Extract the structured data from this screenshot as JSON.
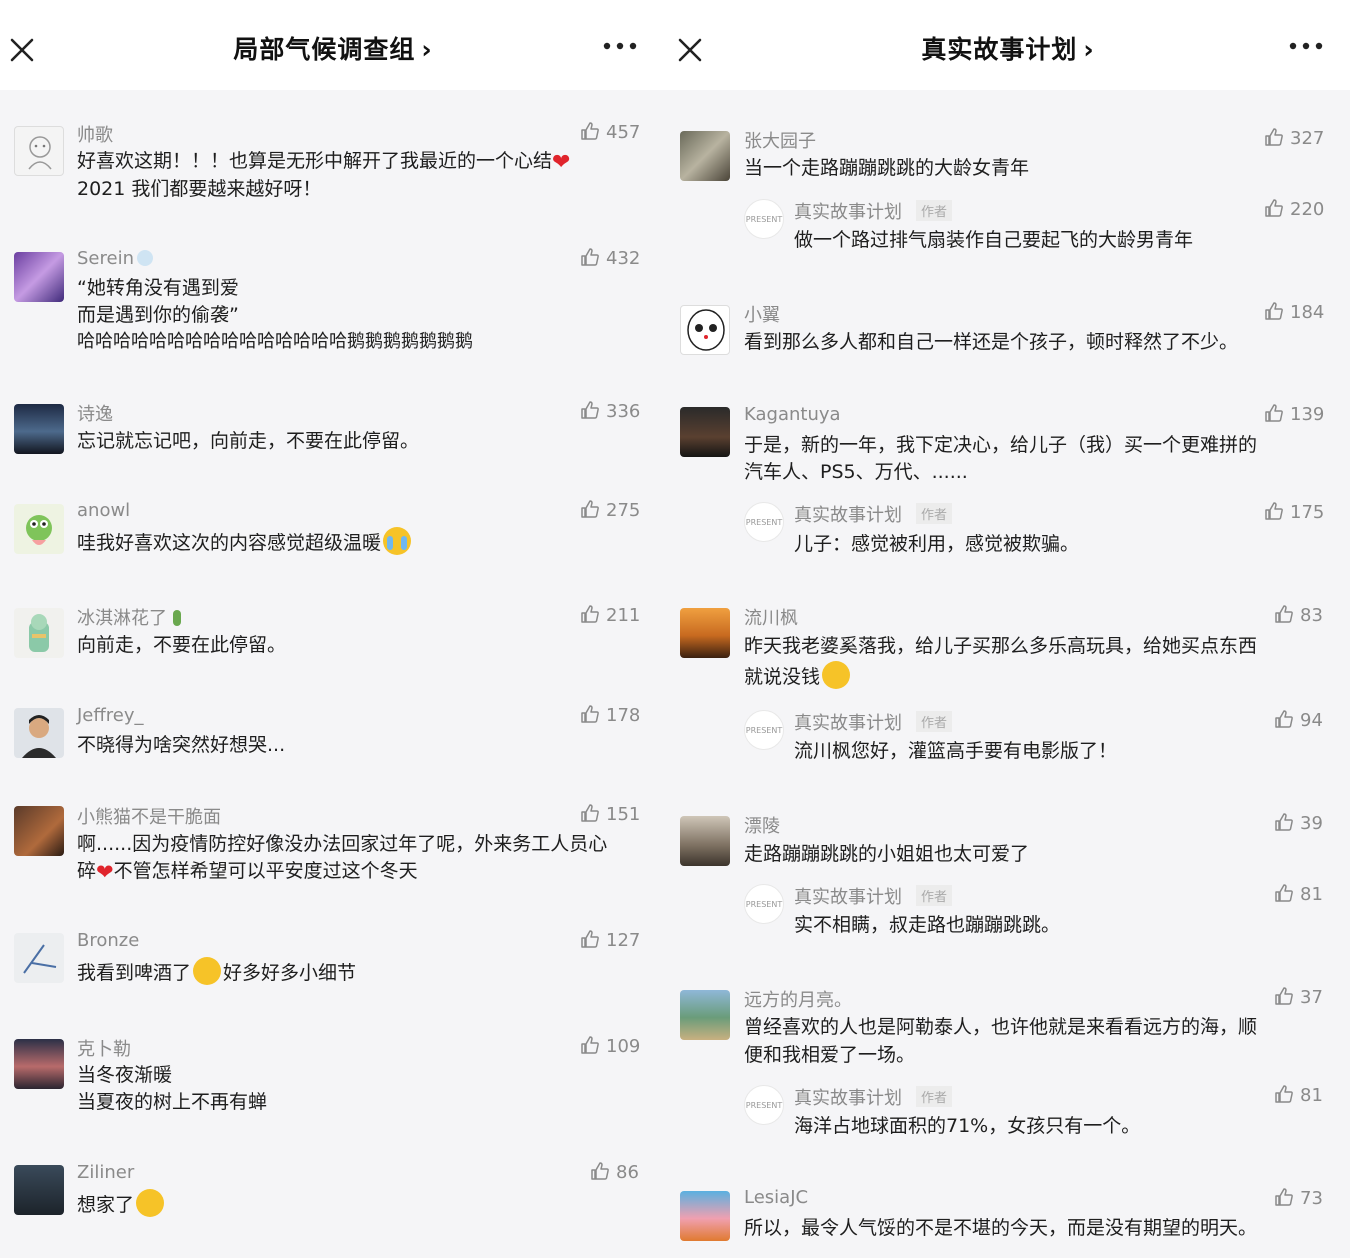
{
  "left": {
    "title": "局部气候调查组",
    "chevron": "›",
    "comments": [
      {
        "user": "帅歌",
        "likes": "457",
        "lines": [
          "好喜欢这期！！！也算是无形中解开了我最近的一个心结",
          "2021 我们都要越来越好呀！"
        ]
      },
      {
        "user": "Serein",
        "likes": "432",
        "lines": [
          "“她转角没有遇到爱",
          "而是遇到你的偷袭”",
          "哈哈哈哈哈哈哈哈哈哈哈哈哈哈哈鹅鹅鹅鹅鹅鹅鹅"
        ]
      },
      {
        "user": "诗逸",
        "likes": "336",
        "lines": [
          "忘记就忘记吧，向前走，不要在此停留。"
        ]
      },
      {
        "user": "anowl",
        "likes": "275",
        "lines": [
          "哇我好喜欢这次的内容感觉超级温暖"
        ]
      },
      {
        "user": "冰淇淋花了",
        "likes": "211",
        "lines": [
          "向前走，不要在此停留。"
        ]
      },
      {
        "user": "Jeffrey_",
        "likes": "178",
        "lines": [
          "不晓得为啥突然好想哭..."
        ]
      },
      {
        "user": "小熊猫不是干脆面",
        "likes": "151",
        "lines": [
          "啊......因为疫情防控好像没办法回家过年了呢，外来务工人员心",
          "碎",
          "不管怎样希望可以平安度过这个冬天"
        ]
      },
      {
        "user": "Bronze",
        "likes": "127",
        "lines": [
          "我看到啤酒了",
          "好多好多小细节"
        ]
      },
      {
        "user": "克卜勒",
        "likes": "109",
        "lines": [
          "当冬夜渐暖",
          "当夏夜的树上不再有蝉"
        ]
      },
      {
        "user": "Ziliner",
        "likes": "86",
        "lines": [
          "想家了"
        ]
      }
    ]
  },
  "right": {
    "title": "真实故事计划",
    "chevron": "›",
    "author_tag": "作者",
    "reply_avatar_text": "PRESENT",
    "comments": [
      {
        "user": "张大园子",
        "likes": "327",
        "lines": [
          "当一个走路蹦蹦跳跳的大龄女青年"
        ],
        "reply": {
          "user": "真实故事计划",
          "likes": "220",
          "lines": [
            "做一个路过排气扇装作自己要起飞的大龄男青年"
          ]
        }
      },
      {
        "user": "小翼",
        "likes": "184",
        "lines": [
          "看到那么多人都和自己一样还是个孩子，顿时释然了不少。"
        ]
      },
      {
        "user": "Kagantuya",
        "likes": "139",
        "lines": [
          "于是，新的一年，我下定决心，给儿子（我）买一个更难拼的",
          "汽车人、PS5、万代、......"
        ],
        "reply": {
          "user": "真实故事计划",
          "likes": "175",
          "lines": [
            "儿子：感觉被利用，感觉被欺骗。"
          ]
        }
      },
      {
        "user": "流川枫",
        "likes": "83",
        "lines": [
          "昨天我老婆奚落我，给儿子买那么多乐高玩具，给她买点东西",
          "就说没钱"
        ],
        "reply": {
          "user": "真实故事计划",
          "likes": "94",
          "lines": [
            "流川枫您好，灌篮高手要有电影版了！"
          ]
        }
      },
      {
        "user": "漂陵",
        "likes": "39",
        "lines": [
          "走路蹦蹦跳跳的小姐姐也太可爱了"
        ],
        "reply": {
          "user": "真实故事计划",
          "likes": "81",
          "lines": [
            "实不相瞒，叔走路也蹦蹦跳跳。"
          ]
        }
      },
      {
        "user": "远方的月亮。",
        "likes": "37",
        "lines": [
          "曾经喜欢的人也是阿勒泰人，也许他就是来看看远方的海，顺",
          "便和我相爱了一场。"
        ],
        "reply": {
          "user": "真实故事计划",
          "likes": "81",
          "lines": [
            "海洋占地球面积的71%，女孩只有一个。"
          ]
        }
      },
      {
        "user": "LesiaJC",
        "likes": "73",
        "lines": [
          "所以，最令人气馁的不是不堪的今天，而是没有期望的明天。"
        ]
      }
    ]
  },
  "colors": {
    "heart": "#e0242c",
    "emoji": "#f6c328",
    "like_gray": "#8a8a8a"
  }
}
